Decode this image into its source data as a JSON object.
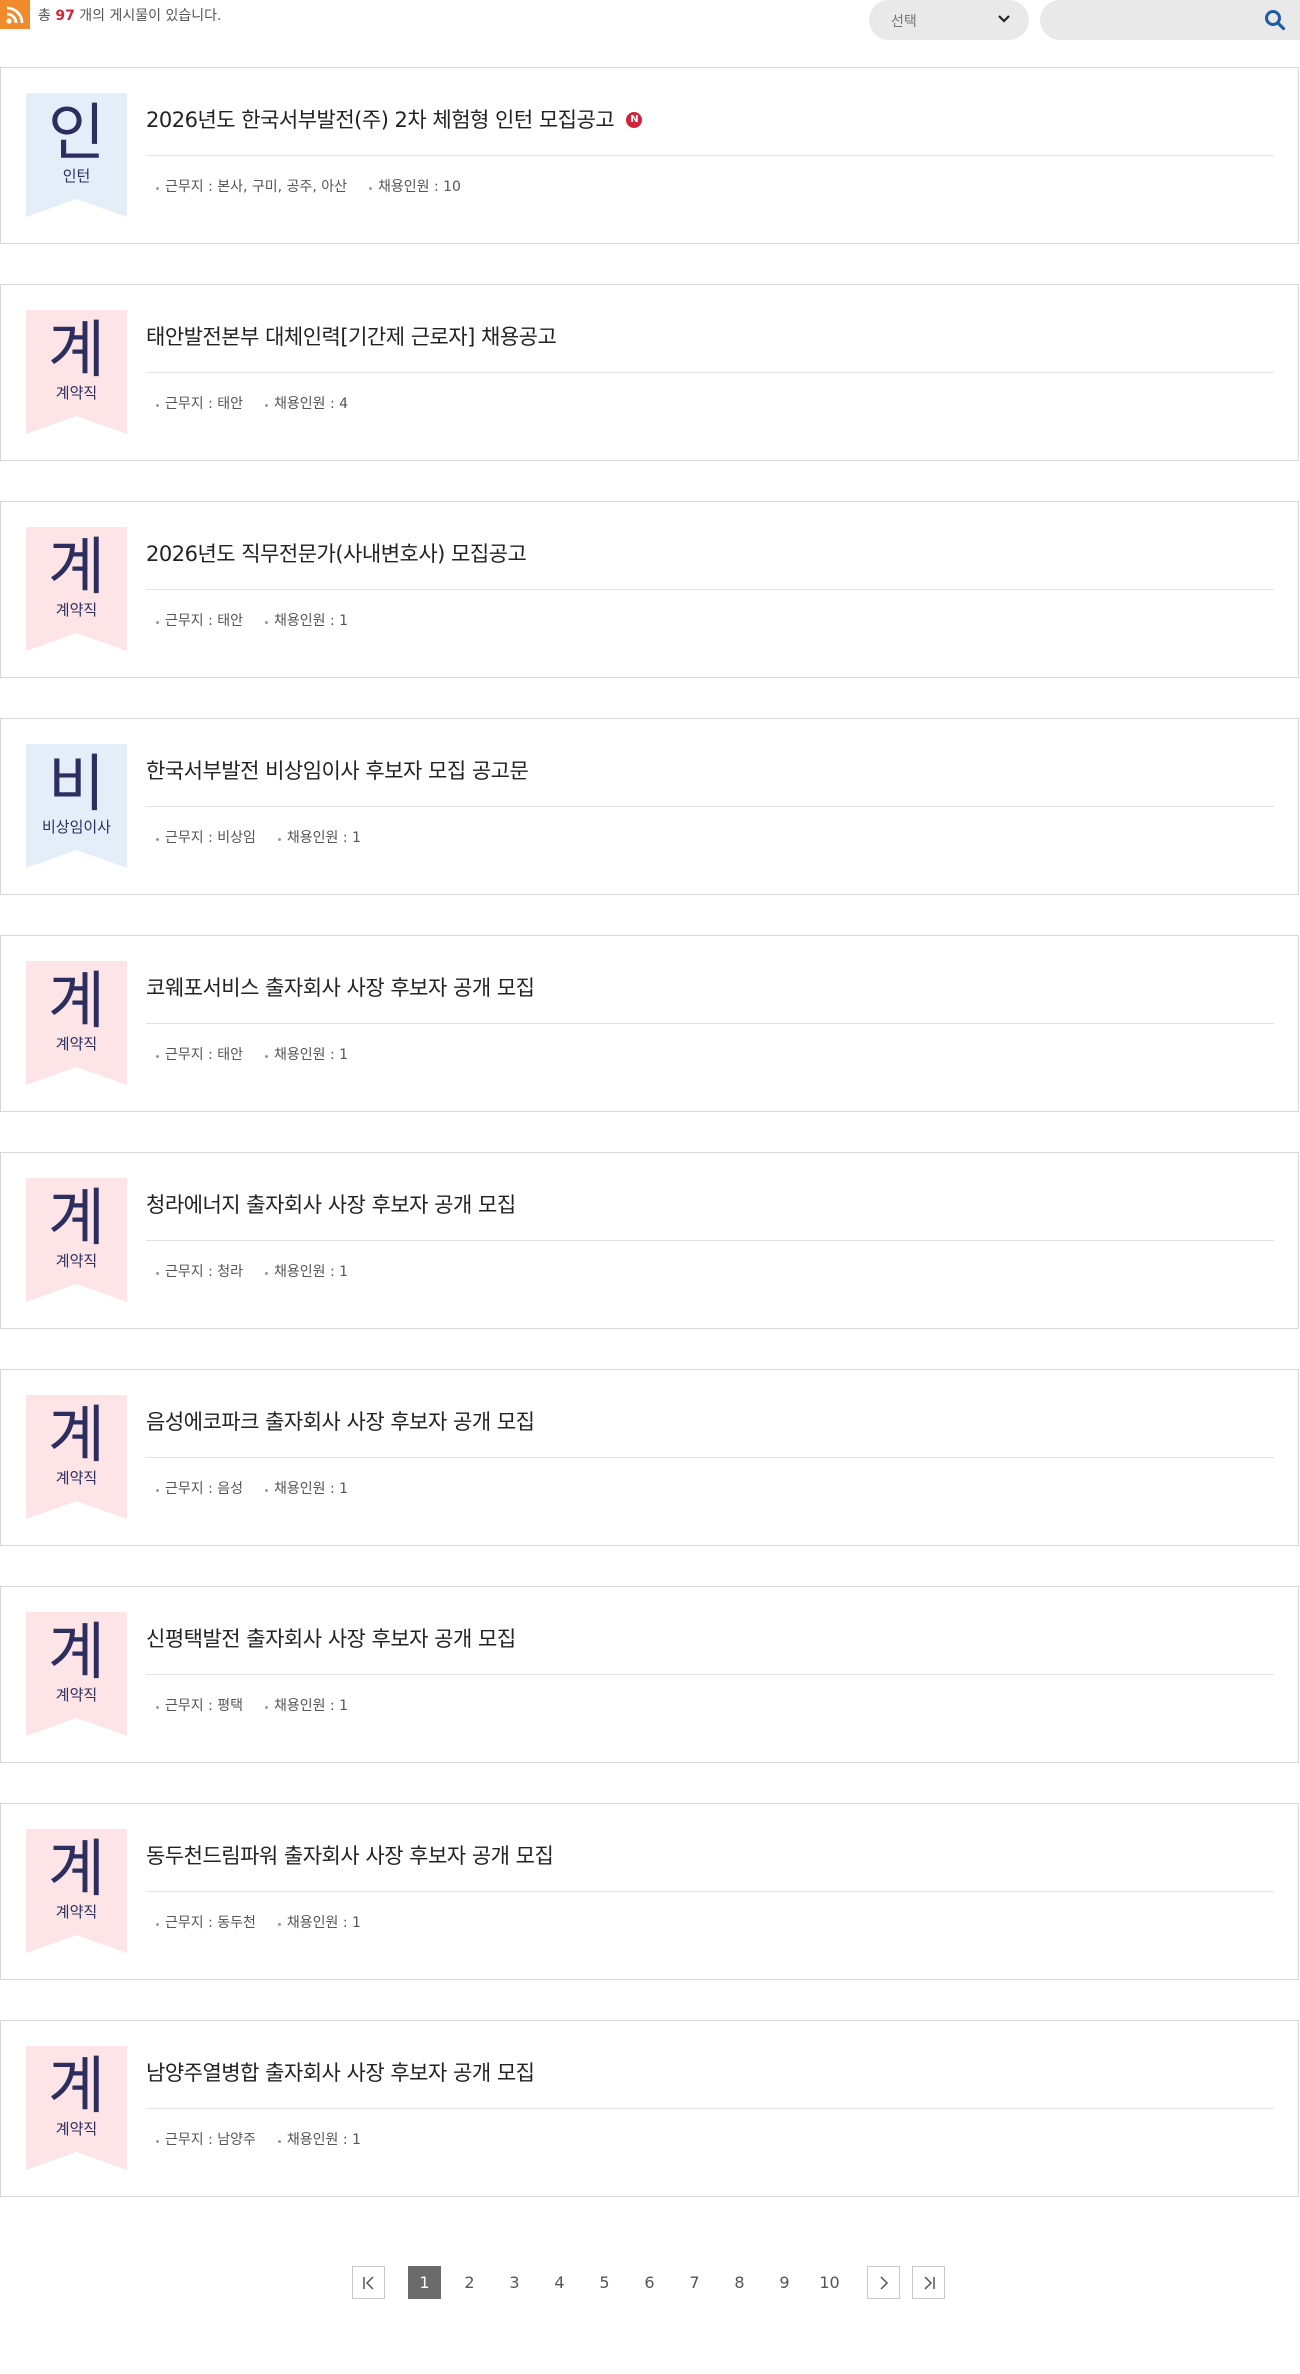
{
  "header": {
    "total_prefix": "총",
    "total_count": "97",
    "total_suffix": "개의 게시물이 있습니다.",
    "select_value": "선택",
    "search_placeholder": ""
  },
  "colors": {
    "intern_badge_bg": "#e3eef8",
    "contract_badge_bg": "#fde4e6",
    "badge_text": "#2b2e5f",
    "accent_red": "#d1243b",
    "rss_orange": "#f08a2b",
    "search_blue": "#1d5da8"
  },
  "icons": {
    "rss": "rss-icon",
    "chevron": "chevron-down-icon",
    "search": "search-icon",
    "new": "new-badge-icon"
  },
  "posts": [
    {
      "badge_big": "인",
      "badge_small": "인턴",
      "badge_type": "intern",
      "title": "2026년도 한국서부발전(주) 2차 체험형 인턴 모집공고",
      "is_new": true,
      "new_label": "N",
      "location": "근무지 : 본사, 구미, 공주, 아산",
      "headcount": "채용인원 : 10"
    },
    {
      "badge_big": "계",
      "badge_small": "계약직",
      "badge_type": "contract",
      "title": "태안발전본부 대체인력[기간제 근로자] 채용공고",
      "is_new": false,
      "location": "근무지 : 태안",
      "headcount": "채용인원 : 4"
    },
    {
      "badge_big": "계",
      "badge_small": "계약직",
      "badge_type": "contract",
      "title": "2026년도 직무전문가(사내변호사) 모집공고",
      "is_new": false,
      "location": "근무지 : 태안",
      "headcount": "채용인원 : 1"
    },
    {
      "badge_big": "비",
      "badge_small": "비상임이사",
      "badge_type": "intern",
      "title": "한국서부발전 비상임이사 후보자 모집 공고문",
      "is_new": false,
      "location": "근무지 : 비상임",
      "headcount": "채용인원 : 1"
    },
    {
      "badge_big": "계",
      "badge_small": "계약직",
      "badge_type": "contract",
      "title": "코웨포서비스 출자회사 사장 후보자 공개 모집",
      "is_new": false,
      "location": "근무지 : 태안",
      "headcount": "채용인원 : 1"
    },
    {
      "badge_big": "계",
      "badge_small": "계약직",
      "badge_type": "contract",
      "title": "청라에너지 출자회사 사장 후보자 공개 모집",
      "is_new": false,
      "location": "근무지 : 청라",
      "headcount": "채용인원 : 1"
    },
    {
      "badge_big": "계",
      "badge_small": "계약직",
      "badge_type": "contract",
      "title": "음성에코파크 출자회사 사장 후보자 공개 모집",
      "is_new": false,
      "location": "근무지 : 음성",
      "headcount": "채용인원 : 1"
    },
    {
      "badge_big": "계",
      "badge_small": "계약직",
      "badge_type": "contract",
      "title": "신평택발전 출자회사 사장 후보자 공개 모집",
      "is_new": false,
      "location": "근무지 : 평택",
      "headcount": "채용인원 : 1"
    },
    {
      "badge_big": "계",
      "badge_small": "계약직",
      "badge_type": "contract",
      "title": "동두천드림파워 출자회사 사장 후보자 공개 모집",
      "is_new": false,
      "location": "근무지 : 동두천",
      "headcount": "채용인원 : 1"
    },
    {
      "badge_big": "계",
      "badge_small": "계약직",
      "badge_type": "contract",
      "title": "남양주열병합 출자회사 사장 후보자 공개 모집",
      "is_new": false,
      "location": "근무지 : 남양주",
      "headcount": "채용인원 : 1"
    }
  ],
  "pagination": {
    "pages": [
      "1",
      "2",
      "3",
      "4",
      "5",
      "6",
      "7",
      "8",
      "9",
      "10"
    ],
    "current": "1"
  }
}
